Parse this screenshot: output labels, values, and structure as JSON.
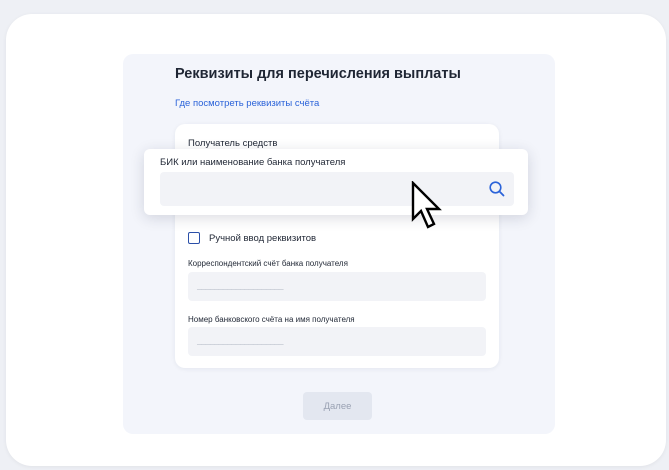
{
  "form": {
    "title": "Реквизиты для перечисления выплаты",
    "help_link": "Где посмотреть реквизиты счёта",
    "recipient_label": "Получатель средств",
    "bank_search": {
      "label": "БИК или наименование банка получателя",
      "value": "",
      "icon": "search-icon"
    },
    "manual_entry": {
      "label": "Ручной ввод реквизитов",
      "checked": false
    },
    "correspondent_account": {
      "label": "Корреспондентский счёт банка получателя",
      "placeholder": "____________________"
    },
    "account_number": {
      "label": "Номер банковского счёта на имя получателя",
      "placeholder": "____________________"
    },
    "next_button": "Далее"
  },
  "colors": {
    "link": "#2b63d9",
    "checkbox_border": "#2b4fa8",
    "disabled_button_bg": "#e3e7f0",
    "disabled_button_text": "#9aa2b3"
  }
}
